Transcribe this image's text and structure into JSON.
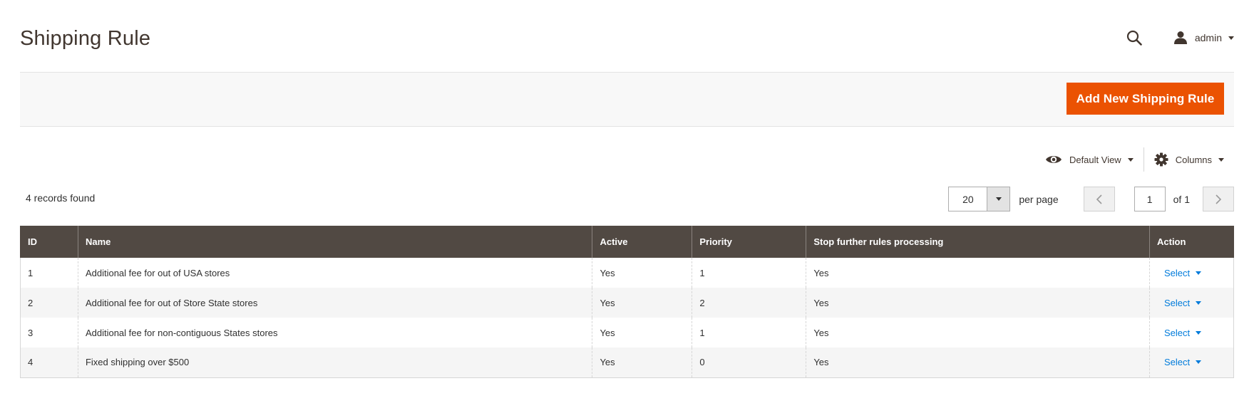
{
  "page": {
    "title": "Shipping Rule"
  },
  "header": {
    "user_name": "admin"
  },
  "actions": {
    "add_button_label": "Add New Shipping Rule"
  },
  "grid_controls": {
    "view_label": "Default View",
    "columns_label": "Columns"
  },
  "records_found": "4 records found",
  "pager": {
    "per_page_value": "20",
    "per_page_label": "per page",
    "current_page": "1",
    "of_label": "of 1"
  },
  "table": {
    "columns": [
      "ID",
      "Name",
      "Active",
      "Priority",
      "Stop further rules processing",
      "Action"
    ],
    "rows": [
      {
        "id": "1",
        "name": "Additional fee for out of USA stores",
        "active": "Yes",
        "priority": "1",
        "stop": "Yes",
        "action": "Select"
      },
      {
        "id": "2",
        "name": "Additional fee for out of Store State stores",
        "active": "Yes",
        "priority": "2",
        "stop": "Yes",
        "action": "Select"
      },
      {
        "id": "3",
        "name": "Additional fee for non-contiguous States stores",
        "active": "Yes",
        "priority": "1",
        "stop": "Yes",
        "action": "Select"
      },
      {
        "id": "4",
        "name": "Fixed shipping over $500",
        "active": "Yes",
        "priority": "0",
        "stop": "Yes",
        "action": "Select"
      }
    ]
  },
  "colors": {
    "accent": "#eb5202",
    "header_bg": "#514943",
    "link": "#007bdb"
  },
  "icons": {
    "search": "search-icon",
    "user": "user-icon",
    "view": "eye-icon",
    "columns": "gear-icon"
  }
}
